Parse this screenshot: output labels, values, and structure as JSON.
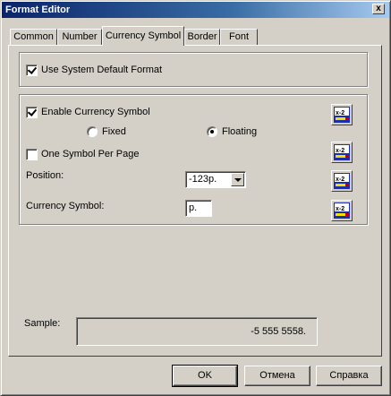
{
  "window": {
    "title": "Format Editor",
    "close_glyph": "x"
  },
  "tabs": [
    {
      "label": "Common",
      "active": false
    },
    {
      "label": "Number",
      "active": false
    },
    {
      "label": "Currency Symbol",
      "active": true
    },
    {
      "label": "Border",
      "active": false
    },
    {
      "label": "Font",
      "active": false
    }
  ],
  "system_format": {
    "label": "Use System Default Format",
    "checked": true
  },
  "currency": {
    "enable_label": "Enable Currency Symbol",
    "enable_checked": true,
    "fixed_label": "Fixed",
    "floating_label": "Floating",
    "selected_mode": "Floating",
    "one_symbol_label": "One Symbol Per Page",
    "one_symbol_checked": false,
    "position_label": "Position:",
    "position_value": "-123р.",
    "symbol_label": "Currency Symbol:",
    "symbol_value": "р."
  },
  "formula_icon": "formula-x2-icon",
  "sample": {
    "label": "Sample:",
    "value": "-5 555 5558."
  },
  "buttons": {
    "ok": "OK",
    "cancel": "Отмена",
    "help": "Справка"
  }
}
